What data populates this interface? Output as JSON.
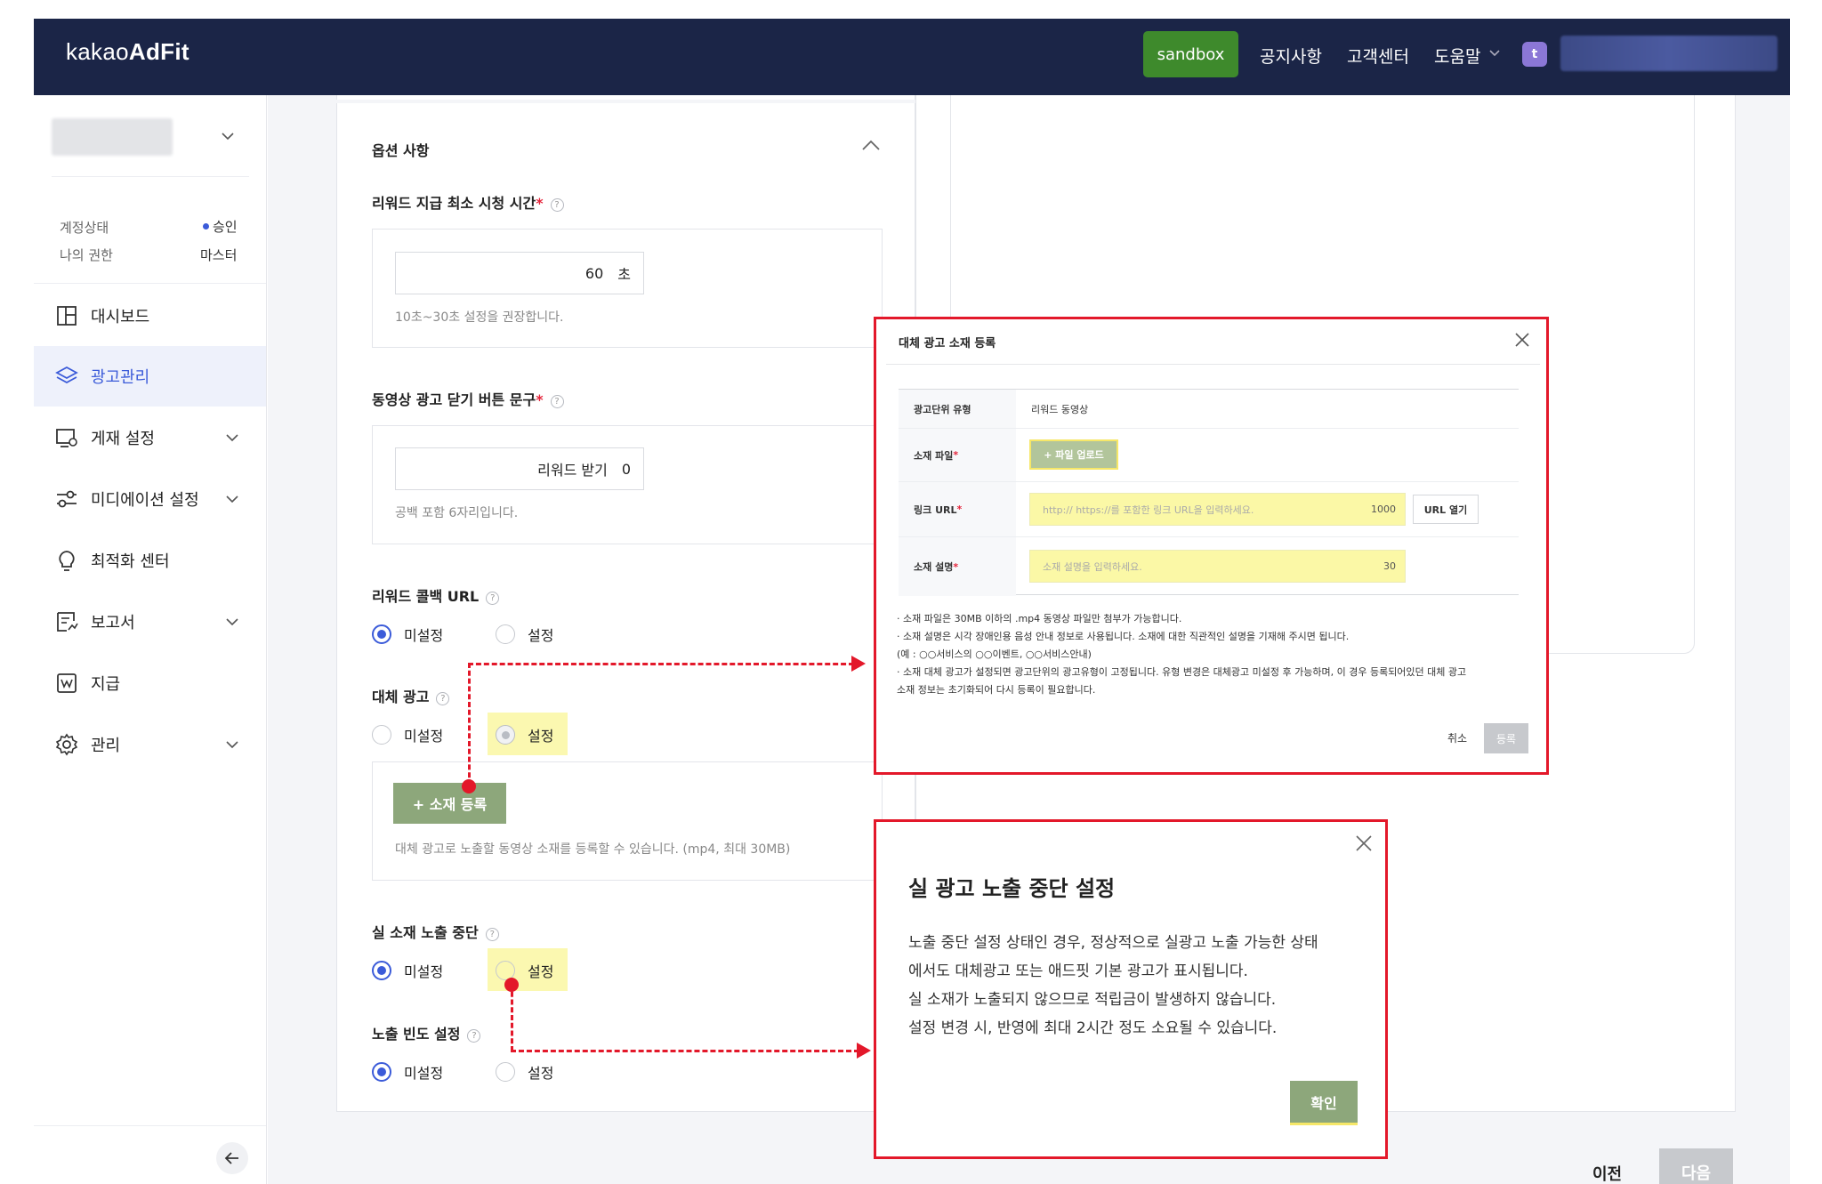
{
  "header": {
    "logo_regular": "kakao",
    "logo_bold": "AdFit",
    "sandbox_label": "sandbox",
    "nav": [
      "공지사항",
      "고객센터",
      "도움말"
    ],
    "avatar_letter": "t"
  },
  "sidebar": {
    "meta": [
      {
        "label": "계정상태",
        "value": "승인"
      },
      {
        "label": "나의 권한",
        "value": "마스터"
      }
    ],
    "items": [
      {
        "label": "대시보드",
        "icon": "dashboard-icon",
        "expandable": false
      },
      {
        "label": "광고관리",
        "icon": "layers-icon",
        "expandable": false,
        "active": true
      },
      {
        "label": "게재 설정",
        "icon": "monitor-icon",
        "expandable": true
      },
      {
        "label": "미디에이션 설정",
        "icon": "mediation-icon",
        "expandable": true
      },
      {
        "label": "최적화 센터",
        "icon": "lightbulb-icon",
        "expandable": false
      },
      {
        "label": "보고서",
        "icon": "report-icon",
        "expandable": true
      },
      {
        "label": "지급",
        "icon": "payment-icon",
        "expandable": false
      },
      {
        "label": "관리",
        "icon": "gear-icon",
        "expandable": true
      }
    ]
  },
  "form": {
    "section_title": "옵션 사항",
    "reward_time": {
      "label": "리워드 지급 최소 시청 시간",
      "value": "60",
      "unit": "초",
      "hint": "10초~30초 설정을 권장합니다."
    },
    "close_text": {
      "label": "동영상 광고 닫기 버튼 문구",
      "value": "리워드 받기",
      "count": "0",
      "hint": "공백 포함 6자리입니다."
    },
    "callback_url": {
      "label": "리워드 콜백 URL",
      "options": [
        "미설정",
        "설정"
      ]
    },
    "fallback_ad": {
      "label": "대체 광고",
      "options": [
        "미설정",
        "설정"
      ],
      "add_button": "+ 소재 등록",
      "hint": "대체 광고로 노출할 동영상 소재를 등록할 수 있습니다. (mp4, 최대 30MB)"
    },
    "stop_real": {
      "label": "실 소재 노출 중단",
      "options": [
        "미설정",
        "설정"
      ]
    },
    "frequency": {
      "label": "노출 빈도 설정",
      "options": [
        "미설정",
        "설정"
      ]
    }
  },
  "modal1": {
    "title": "대체 광고 소재 등록",
    "rows": {
      "unit_type_label": "광고단위 유형",
      "unit_type_value": "리워드 동영상",
      "file_label": "소재 파일",
      "upload_button": "+ 파일 업로드",
      "link_label": "링크 URL",
      "link_placeholder": "http:// https://를 포함한 링크 URL을 입력하세요.",
      "link_count": "1000",
      "open_url_button": "URL 열기",
      "desc_label": "소재 설명",
      "desc_placeholder": "소재 설명을 입력하세요.",
      "desc_count": "30"
    },
    "notes": [
      "· 소재 파일은 30MB 이하의 .mp4 동영상 파일만 첨부가 가능합니다.",
      "· 소재 설명은 시각 장애인용 음성 안내 정보로 사용됩니다. 소재에 대한 직관적인 설명을 기재해 주시면 됩니다.",
      "(예 : ○○서비스의 ○○이벤트, ○○서비스안내)",
      "· 소재 대체 광고가 설정되면 광고단위의 광고유형이 고정됩니다. 유형 변경은 대체광고 미설정 후 가능하며, 이 경우 등록되어있던 대체 광고",
      "소재 정보는 초기화되어 다시 등록이 필요합니다."
    ],
    "cancel": "취소",
    "submit": "등록"
  },
  "modal2": {
    "title": "실 광고 노출 중단 설정",
    "lines": [
      "노출 중단 설정 상태인 경우, 정상적으로 실광고 노출 가능한 상태",
      "에서도 대체광고 또는 애드핏 기본 광고가 표시됩니다.",
      "실 소재가 노출되지 않으므로 적립금이 발생하지 않습니다.",
      "설정 변경 시, 반영에 최대 2시간 정도 소요될 수 있습니다."
    ],
    "ok": "확인"
  },
  "footer": {
    "prev": "이전",
    "next": "다음"
  },
  "colors": {
    "header_bg": "#1b2547",
    "sandbox_green": "#3e8a2c",
    "accent_blue": "#3b5bd9",
    "olive_button": "#8da77b",
    "annotation_red": "#e3182a",
    "highlight_yellow": "#fbf8b0"
  }
}
